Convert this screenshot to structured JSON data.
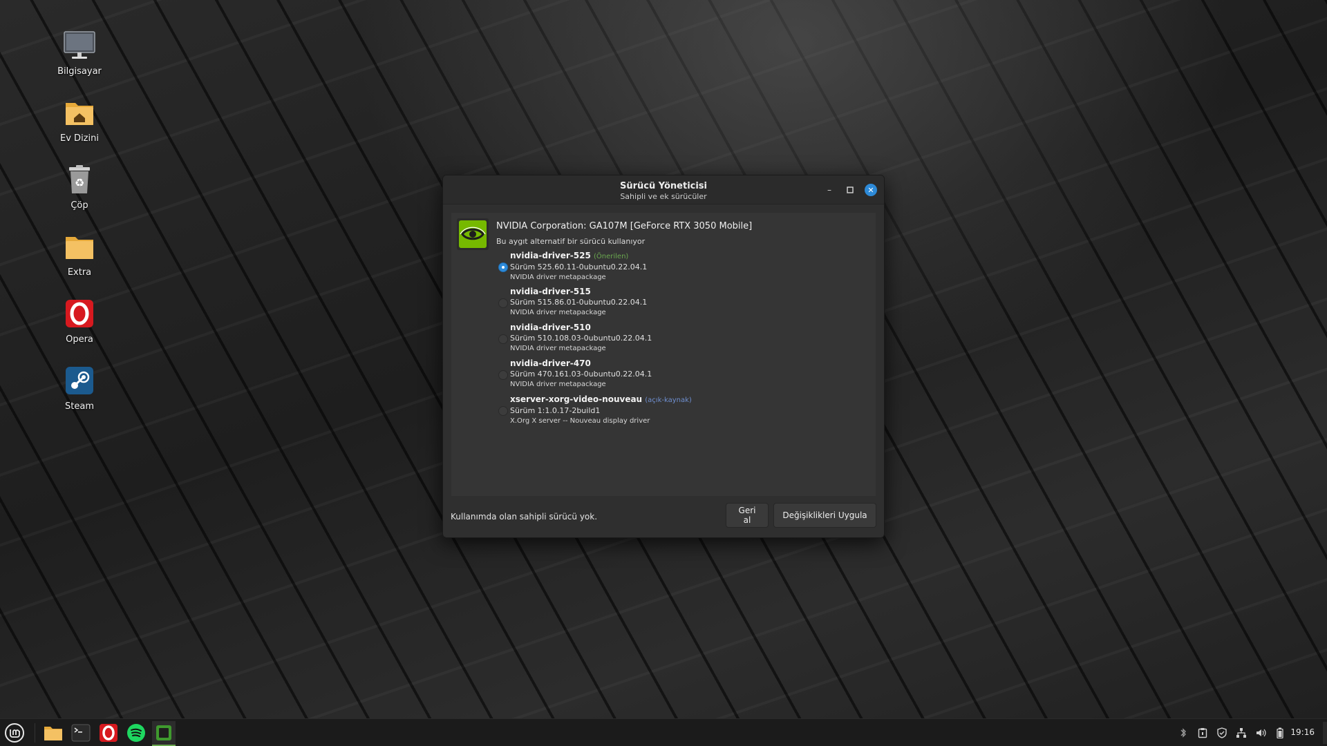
{
  "desktop": {
    "icons": [
      {
        "label": "Bilgisayar",
        "icon": "computer-icon"
      },
      {
        "label": "Ev Dizini",
        "icon": "home-folder-icon"
      },
      {
        "label": "Çöp",
        "icon": "trash-icon"
      },
      {
        "label": "Extra",
        "icon": "folder-icon"
      },
      {
        "label": "Opera",
        "icon": "opera-icon"
      },
      {
        "label": "Steam",
        "icon": "steam-icon"
      }
    ]
  },
  "dialog": {
    "title": "Sürücü Yöneticisi",
    "subtitle": "Sahipli ve ek sürücüler",
    "device": {
      "name": "NVIDIA Corporation: GA107M [GeForce RTX 3050 Mobile]",
      "status": "Bu aygıt alternatif bir sürücü kullanıyor"
    },
    "drivers": [
      {
        "name": "nvidia-driver-525",
        "tag": "(Önerilen)",
        "version": "Sürüm 525.60.11-0ubuntu0.22.04.1",
        "desc": "NVIDIA driver metapackage",
        "selected": true
      },
      {
        "name": "nvidia-driver-515",
        "tag": "",
        "version": "Sürüm 515.86.01-0ubuntu0.22.04.1",
        "desc": "NVIDIA driver metapackage",
        "selected": false
      },
      {
        "name": "nvidia-driver-510",
        "tag": "",
        "version": "Sürüm 510.108.03-0ubuntu0.22.04.1",
        "desc": "NVIDIA driver metapackage",
        "selected": false
      },
      {
        "name": "nvidia-driver-470",
        "tag": "",
        "version": "Sürüm 470.161.03-0ubuntu0.22.04.1",
        "desc": "NVIDIA driver metapackage",
        "selected": false
      },
      {
        "name": "xserver-xorg-video-nouveau",
        "tag": "(açık-kaynak)",
        "version": "Sürüm 1:1.0.17-2build1",
        "desc": "X.Org X server -- Nouveau display driver",
        "selected": false
      }
    ],
    "footer_status": "Kullanımda olan sahipli sürücü yok.",
    "revert_label": "Geri al",
    "apply_label": "Değişiklikleri Uygula"
  },
  "taskbar": {
    "clock": "19:16"
  },
  "colors": {
    "accent": "#2d8ad8",
    "recommended": "#6aa84f",
    "open_source": "#6f8fd0"
  }
}
